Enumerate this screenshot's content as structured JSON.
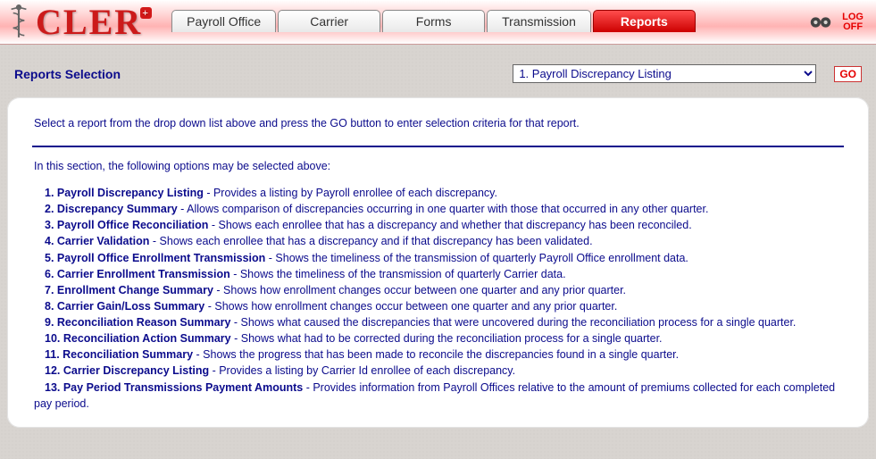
{
  "app": {
    "logo_text": "CLER"
  },
  "tabs": {
    "payroll_office": "Payroll Office",
    "carrier": "Carrier",
    "forms": "Forms",
    "transmission": "Transmission",
    "reports": "Reports"
  },
  "logoff": {
    "line1": "LOG",
    "line2": "OFF"
  },
  "selection": {
    "title": "Reports Selection",
    "selected": "1. Payroll Discrepancy Listing",
    "go": "GO"
  },
  "content": {
    "intro": "Select a report from the drop down list above and press the GO button to enter selection criteria for that report.",
    "options_intro": "In this section, the following options may be selected above:",
    "items": [
      {
        "num": "1.",
        "title": "Payroll Discrepancy Listing",
        "desc": " - Provides a listing by Payroll enrollee of each discrepancy."
      },
      {
        "num": "2.",
        "title": "Discrepancy Summary",
        "desc": " - Allows comparison of discrepancies occurring in one quarter with those that occurred in any other quarter."
      },
      {
        "num": "3.",
        "title": "Payroll Office Reconciliation",
        "desc": " - Shows each enrollee that has a discrepancy and whether that discrepancy has been reconciled."
      },
      {
        "num": "4.",
        "title": "Carrier Validation",
        "desc": " - Shows each enrollee that has a discrepancy and if that discrepancy has been validated."
      },
      {
        "num": "5.",
        "title": "Payroll Office Enrollment Transmission",
        "desc": " - Shows the timeliness of the transmission of quarterly Payroll Office enrollment data."
      },
      {
        "num": "6.",
        "title": "Carrier Enrollment Transmission",
        "desc": " - Shows the timeliness of the transmission of quarterly Carrier data."
      },
      {
        "num": "7.",
        "title": "Enrollment Change Summary",
        "desc": " - Shows how enrollment changes occur between one quarter and any prior quarter."
      },
      {
        "num": "8.",
        "title": "Carrier Gain/Loss Summary",
        "desc": " - Shows how enrollment changes occur between one quarter and any prior quarter."
      },
      {
        "num": "9.",
        "title": "Reconciliation Reason Summary",
        "desc": " - Shows what caused the discrepancies that were uncovered during the reconciliation process for a single quarter."
      },
      {
        "num": "10.",
        "title": "Reconciliation Action Summary",
        "desc": " - Shows what had to be corrected during the reconciliation process for a single quarter."
      },
      {
        "num": "11.",
        "title": "Reconciliation Summary",
        "desc": " - Shows the progress that has been made to reconcile the discrepancies found in a single quarter."
      },
      {
        "num": "12.",
        "title": "Carrier Discrepancy Listing",
        "desc": " - Provides a listing by Carrier Id enrollee of each discrepancy."
      },
      {
        "num": "13.",
        "title": "Pay Period Transmissions Payment Amounts",
        "desc": " - Provides information from Payroll Offices relative to the amount of premiums collected for each completed pay period."
      }
    ]
  }
}
